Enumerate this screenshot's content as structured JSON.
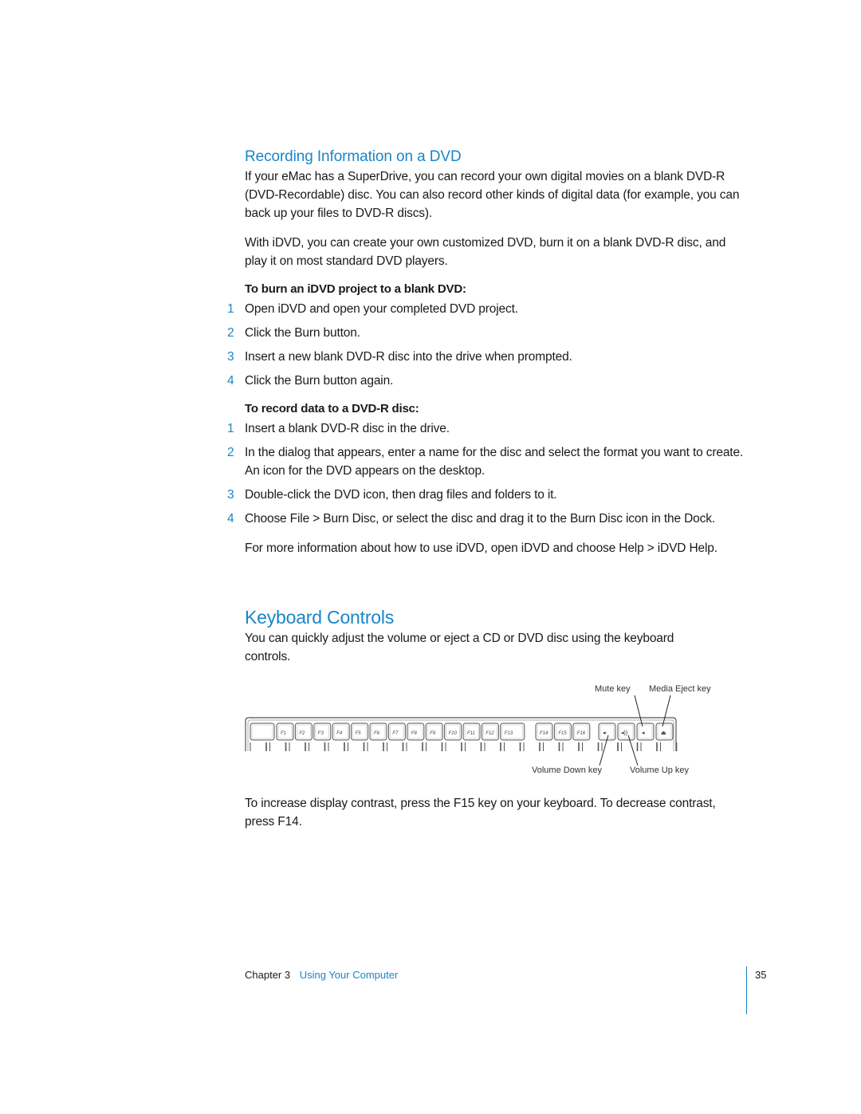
{
  "section1": {
    "heading": "Recording Information on a DVD",
    "para1": "If your eMac has a SuperDrive, you can record your own digital movies on a blank DVD-R (DVD-Recordable) disc. You can also record other kinds of digital data (for example, you can back up your files to DVD-R discs).",
    "para2": "With iDVD, you can create your own customized DVD, burn it on a blank DVD-R disc, and play it on most standard DVD players.",
    "procedure1": {
      "title": "To burn an iDVD project to a blank DVD:",
      "steps": [
        {
          "num": "1",
          "text": "Open iDVD and open your completed DVD project."
        },
        {
          "num": "2",
          "text": "Click the Burn button."
        },
        {
          "num": "3",
          "text": "Insert a new blank DVD-R disc into the drive when prompted."
        },
        {
          "num": "4",
          "text": "Click the Burn button again."
        }
      ]
    },
    "procedure2": {
      "title": "To record data to a DVD-R disc:",
      "steps": [
        {
          "num": "1",
          "text": "Insert a blank DVD-R disc in the drive."
        },
        {
          "num": "2",
          "text": "In the dialog that appears, enter a name for the disc and select the format you want to create. An icon for the DVD appears on the desktop."
        },
        {
          "num": "3",
          "text": "Double-click the DVD icon, then drag files and folders to it."
        },
        {
          "num": "4",
          "text": "Choose File > Burn Disc, or select the disc and drag it to the Burn Disc icon in the Dock."
        }
      ]
    },
    "para3": "For more information about how to use iDVD, open iDVD and choose Help > iDVD Help."
  },
  "section2": {
    "heading": "Keyboard Controls",
    "para1": "You can quickly adjust the volume or eject a CD or DVD disc using the keyboard controls.",
    "keyboard": {
      "labels": {
        "mute": "Mute key",
        "eject": "Media Eject key",
        "vol_down": "Volume Down key",
        "vol_up": "Volume Up key"
      },
      "fkeys": [
        "F1",
        "F2",
        "F3",
        "F4",
        "F5",
        "F6",
        "F7",
        "F8",
        "F9",
        "F10",
        "F11",
        "F12",
        "F13"
      ],
      "fkeys2": [
        "F14",
        "F15",
        "F16"
      ]
    },
    "para2": "To increase display contrast, press the F15 key on your keyboard. To decrease contrast, press F14."
  },
  "footer": {
    "chapter": "Chapter 3",
    "chapter_title": "Using Your Computer",
    "page_number": "35"
  }
}
